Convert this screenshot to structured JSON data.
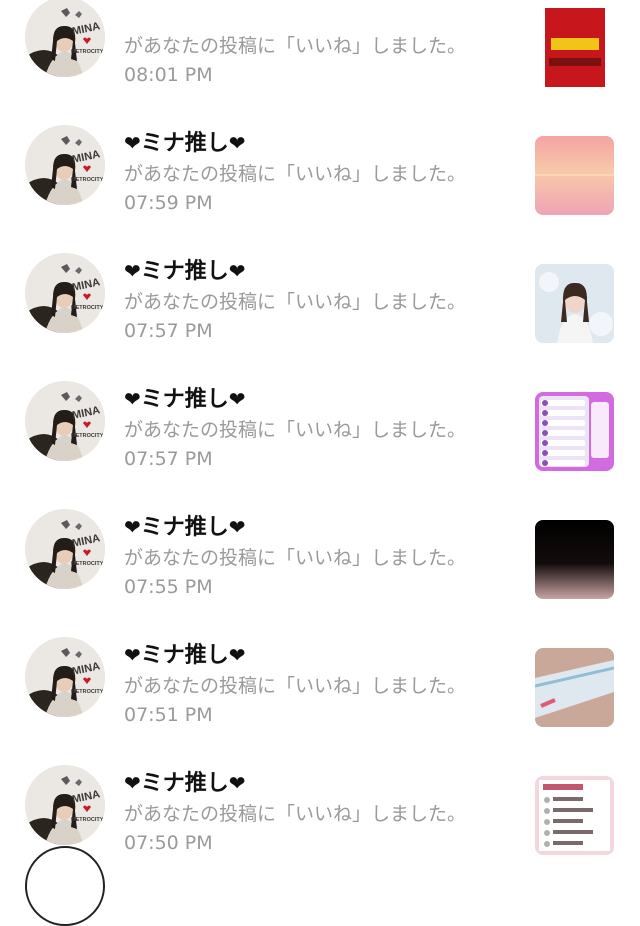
{
  "notifications": [
    {
      "username": "",
      "message": "があなたの投稿に「いいね」しました。",
      "time": "08:01 PM",
      "thumb_icon": "snack-bag-thumbnail",
      "thumb_colors": [
        "#c8161d",
        "#f0c419"
      ]
    },
    {
      "username": "ミナ推し",
      "message": "があなたの投稿に「いいね」しました。",
      "time": "07:59 PM",
      "thumb_icon": "sunset-sea-thumbnail",
      "thumb_colors": [
        "#f4a3a3",
        "#f7c9a9",
        "#f0a4b5"
      ]
    },
    {
      "username": "ミナ推し",
      "message": "があなたの投稿に「いいね」しました。",
      "time": "07:57 PM",
      "thumb_icon": "portrait-photo-thumbnail",
      "thumb_colors": [
        "#dfe7ef",
        "#f5f5f5"
      ]
    },
    {
      "username": "ミナ推し",
      "message": "があなたの投稿に「いいね」しました。",
      "time": "07:57 PM",
      "thumb_icon": "purple-list-thumbnail",
      "thumb_colors": [
        "#d26be0",
        "#ece3f6"
      ]
    },
    {
      "username": "ミナ推し",
      "message": "があなたの投稿に「いいね」しました。",
      "time": "07:55 PM",
      "thumb_icon": "dark-gradient-thumbnail",
      "thumb_colors": [
        "#000000",
        "#c8a3a3"
      ]
    },
    {
      "username": "ミナ推し",
      "message": "があなたの投稿に「いいね」しました。",
      "time": "07:51 PM",
      "thumb_icon": "product-tube-thumbnail",
      "thumb_colors": [
        "#c9a89a",
        "#dfe8ee"
      ]
    },
    {
      "username": "ミナ推し",
      "message": "があなたの投稿に「いいね」しました。",
      "time": "07:50 PM",
      "thumb_icon": "pink-note-thumbnail",
      "thumb_colors": [
        "#f3d7dc",
        "#ffffff"
      ]
    }
  ],
  "avatar_badge": {
    "line1": "MINA",
    "line2": "METROCITY"
  },
  "heart_glyph": "❤"
}
